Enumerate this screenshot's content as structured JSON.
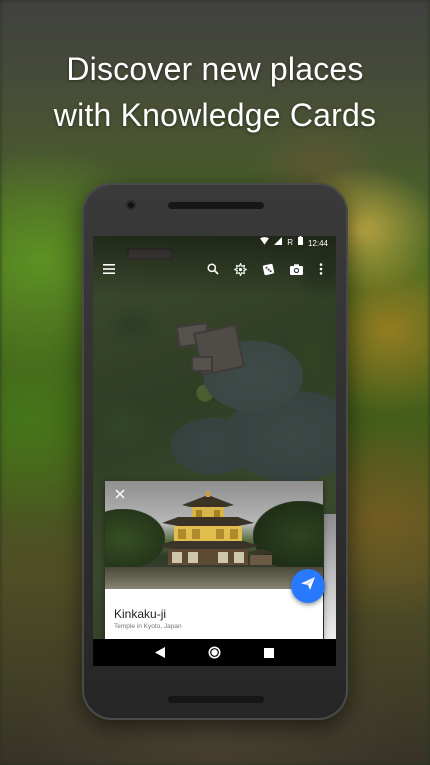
{
  "promo": {
    "headline_line1": "Discover new places",
    "headline_line2": "with Knowledge Cards"
  },
  "status_bar": {
    "wifi_icon": "wifi-icon",
    "signal_icon": "signal-icon",
    "roaming_label": "R",
    "battery_icon": "battery-icon",
    "time": "12:44"
  },
  "toolbar": {
    "icons": [
      "menu-icon",
      "search-icon",
      "voyager-icon",
      "feeling-lucky-dice-icon",
      "camera-icon",
      "more-vert-icon"
    ]
  },
  "knowledge_card": {
    "title": "Kinkaku-ji",
    "subtitle": "Temple in Kyoto, Japan",
    "close_icon": "close-icon",
    "share_icon": "send-icon"
  },
  "navigation": {
    "icons": [
      "back-icon",
      "home-icon",
      "recents-icon"
    ]
  },
  "colors": {
    "fab": "#2979ff",
    "card_background": "#ffffff",
    "headline_text": "#ffffff"
  }
}
